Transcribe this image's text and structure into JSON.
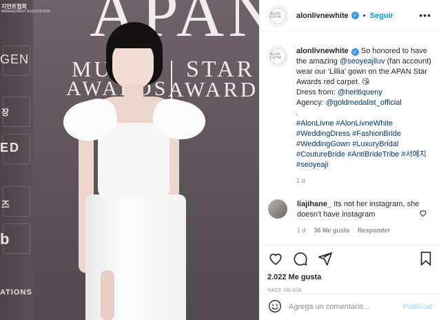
{
  "post": {
    "username": "alonlivnewhite",
    "avatar_text": "ALON LIVNE",
    "follow_label": "Seguir",
    "more_label": "•••",
    "caption": {
      "username": "alonlivnewhite",
      "text_1": " So honored to have the amazing ",
      "mention_1": "@seoyeajiluv",
      "text_2": " (fan account) wear our 'Lillia' gown on the APAN Star Awards red carpet. 😘",
      "dress_label": "Dress from: ",
      "mention_2": "@heritiqueny",
      "agency_label": "Agency: ",
      "mention_3": "@goldmedalist_official",
      "dot": ".",
      "hashtags": "#AlonLivne #AlonLivneWhite #WeddingDress #FashionBride #WeddingGown #LuxuryBridal #CoutureBride #AntiBrideTribe #서예지 #seoyeaji"
    },
    "caption_time": "1 d",
    "comment": {
      "username": "liajihane_",
      "text": " Its not her instagram, she doesn't have instagram",
      "time": "1 d",
      "likes": "36 Me gusta",
      "reply": "Responder"
    },
    "likes": "2.022 Me gusta",
    "timestamp": "HACE UN DÍA",
    "comment_placeholder": "Agrega un comentario...",
    "post_button": "Publicar"
  },
  "photo": {
    "sign_apan": "APAN",
    "sign_music": "MUS",
    "sign_awards_1": "AWARDS",
    "sign_star": "STAR",
    "sign_awards_2": "AWARDS",
    "strip_1": "지먼트협회",
    "strip_1b": "MANAGEMENT ASSOCIATION",
    "strip_2": "GEN",
    "strip_3": "장",
    "strip_4": "ED",
    "strip_5": "즈",
    "strip_6": "b",
    "strip_7": "ATIONS"
  },
  "colors": {
    "link": "#00376b",
    "follow": "#0095f6",
    "verified": "#3897f0",
    "muted": "#8e8e8e",
    "post_button_disabled": "#b2dffc"
  },
  "icons": [
    "heart-icon",
    "comment-icon",
    "share-icon",
    "bookmark-icon",
    "emoji-icon",
    "verified-badge-icon",
    "more-options-icon"
  ]
}
